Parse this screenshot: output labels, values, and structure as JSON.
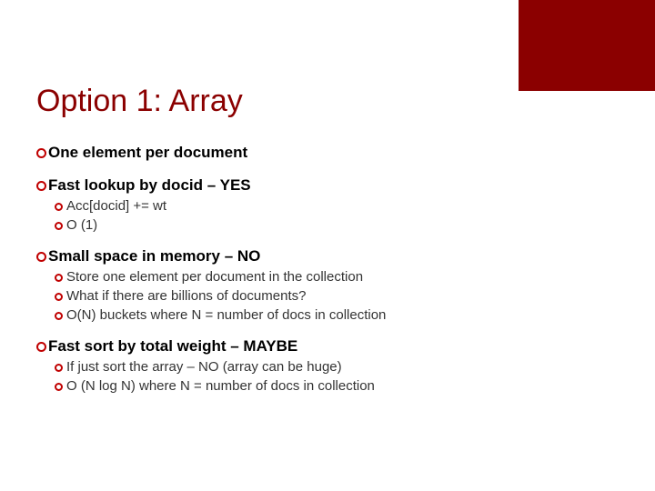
{
  "title": "Option 1: Array",
  "bullets": {
    "b0": {
      "text": "One element per document"
    },
    "b1": {
      "text": "Fast lookup by docid – YES",
      "subs": {
        "s0": "Acc[docid] += wt",
        "s1": "O (1)"
      }
    },
    "b2": {
      "text": "Small space in memory – NO",
      "subs": {
        "s0": "Store one element per document in the collection",
        "s1": "What if there are billions of documents?",
        "s2": "O(N) buckets where N = number of docs in collection"
      }
    },
    "b3": {
      "text": "Fast sort by total weight – MAYBE",
      "subs": {
        "s0": "If just sort the array – NO (array can be huge)",
        "s1": "O (N log N) where N = number of docs in collection"
      }
    }
  }
}
